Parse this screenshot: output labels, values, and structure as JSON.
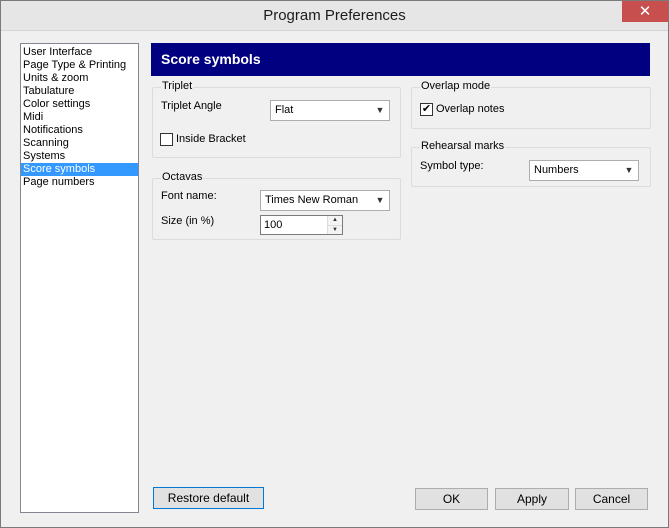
{
  "window": {
    "title": "Program Preferences",
    "close_glyph": "✕"
  },
  "nav": {
    "items": [
      {
        "label": "User Interface",
        "selected": false
      },
      {
        "label": "Page Type & Printing",
        "selected": false
      },
      {
        "label": "Units & zoom",
        "selected": false
      },
      {
        "label": "Tabulature",
        "selected": false
      },
      {
        "label": "Color settings",
        "selected": false
      },
      {
        "label": "Midi",
        "selected": false
      },
      {
        "label": "Notifications",
        "selected": false
      },
      {
        "label": "Scanning",
        "selected": false
      },
      {
        "label": "Systems",
        "selected": false
      },
      {
        "label": "Score symbols",
        "selected": true
      },
      {
        "label": "Page numbers",
        "selected": false
      }
    ]
  },
  "panel": {
    "header": "Score symbols",
    "triplet": {
      "group_label": "Triplet",
      "angle_label": "Triplet Angle",
      "angle_value": "Flat",
      "inside_bracket_label": "Inside Bracket",
      "inside_bracket_checked": false
    },
    "octavas": {
      "group_label": "Octavas",
      "font_label": "Font name:",
      "font_value": "Times New Roman",
      "size_label": "Size (in %)",
      "size_value": "100"
    },
    "overlap": {
      "group_label": "Overlap mode",
      "overlap_notes_label": "Overlap notes",
      "overlap_notes_checked": true
    },
    "rehearsal": {
      "group_label": "Rehearsal marks",
      "symbol_type_label": "Symbol type:",
      "symbol_type_value": "Numbers"
    }
  },
  "buttons": {
    "restore": "Restore default",
    "ok": "OK",
    "apply": "Apply",
    "cancel": "Cancel"
  },
  "icons": {
    "chevron": "chevron-down-icon",
    "spin_up": "arrow-up-icon",
    "spin_down": "arrow-down-icon",
    "check": "checkmark-icon"
  },
  "colors": {
    "header_band": "#000080",
    "selection": "#3399ff",
    "close_button": "#c7504f"
  }
}
